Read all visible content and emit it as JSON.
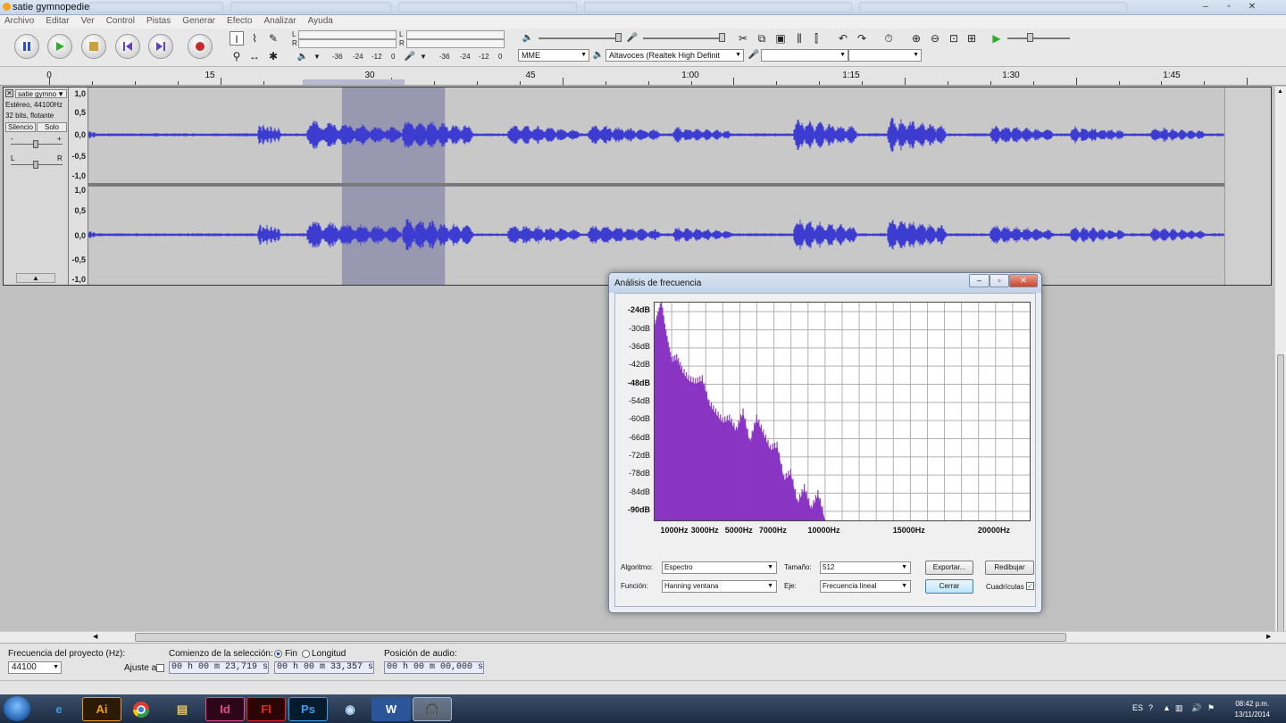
{
  "window": {
    "title": "satie gymnopedie"
  },
  "menu": [
    "Archivo",
    "Editar",
    "Ver",
    "Control",
    "Pistas",
    "Generar",
    "Efecto",
    "Analizar",
    "Ayuda"
  ],
  "toolbar": {
    "meter_L": "L",
    "meter_R": "R",
    "meter_scale": [
      "-36",
      "-24",
      "-12",
      "0"
    ],
    "host": "MME",
    "output_device": "Altavoces (Realtek High Definit",
    "input_device": "",
    "input_channels": ""
  },
  "ruler": {
    "labels": [
      "0",
      "15",
      "30",
      "45",
      "1:00",
      "1:15",
      "1:30",
      "1:45"
    ]
  },
  "track": {
    "name": "satie gymno",
    "info1": "Estéreo, 44100Hz",
    "info2": "32 bits, flotante",
    "mute": "Silencio",
    "solo": "Solo",
    "gain_minus": "-",
    "gain_plus": "+",
    "pan_L": "L",
    "pan_R": "R",
    "scale_top": [
      "1,0",
      "0,5",
      "0,0",
      "-0,5",
      "-1,0"
    ],
    "scale_bottom": [
      "1,0",
      "0,5",
      "0,0",
      "-0,5",
      "-1,0"
    ],
    "selection_seconds": [
      23.719,
      33.357
    ],
    "waveform_color": "#3c3cd0"
  },
  "dialog": {
    "title": "Análisis de frecuencia",
    "db_labels": [
      "-24dB",
      "-30dB",
      "-36dB",
      "-42dB",
      "-48dB",
      "-54dB",
      "-60dB",
      "-66dB",
      "-72dB",
      "-78dB",
      "-84dB",
      "-90dB"
    ],
    "hz_labels": [
      "1000Hz",
      "3000Hz",
      "5000Hz",
      "7000Hz",
      "10000Hz",
      "15000Hz",
      "20000Hz"
    ],
    "algoritmo_label": "Algoritmo:",
    "algoritmo_value": "Espectro",
    "tamano_label": "Tamaño:",
    "tamano_value": "512",
    "funcion_label": "Función:",
    "funcion_value": "Hanning ventana",
    "eje_label": "Eje:",
    "eje_value": "Frecuencia lineal",
    "exportar": "Exportar...",
    "redibujar": "Redibujar",
    "cerrar": "Cerrar",
    "cuadriculas": "Cuadrículas",
    "spectrum_color": "#8a35c4"
  },
  "chart_data": {
    "type": "area",
    "xlabel": "",
    "ylabel": "",
    "xlim": [
      0,
      22050
    ],
    "ylim": [
      -93,
      -21
    ],
    "x": [
      0,
      200,
      400,
      600,
      800,
      1000,
      1300,
      1600,
      2000,
      2400,
      2800,
      3200,
      3600,
      4000,
      4400,
      4800,
      5200,
      5600,
      6000,
      6400,
      6800,
      7200,
      7600,
      8000,
      8400,
      8800,
      9200,
      9600,
      10000
    ],
    "values": [
      -30,
      -26,
      -22,
      -30,
      -36,
      -41,
      -40,
      -44,
      -47,
      -48,
      -47,
      -55,
      -58,
      -61,
      -60,
      -64,
      -58,
      -68,
      -60,
      -65,
      -70,
      -69,
      -80,
      -78,
      -88,
      -83,
      -90,
      -85,
      -93
    ]
  },
  "selection_bar": {
    "project_rate_label": "Frecuencia del proyecto (Hz):",
    "project_rate_value": "44100",
    "snap_label": "Ajuste a",
    "selection_start_label": "Comienzo de la selección:",
    "fin_label": "Fin",
    "longitud_label": "Longitud",
    "audio_position_label": "Posición de audio:",
    "start_time": "00 h 00 m 23,719 s",
    "end_time": "00 h 00 m 33,357 s",
    "audio_position": "00 h 00 m 00,000 s"
  },
  "taskbar": {
    "lang": "ES",
    "time": "08:42 p.m.",
    "date": "13/11/2014",
    "apps": [
      "Ai",
      "Id",
      "Fl",
      "Ps",
      "W"
    ]
  }
}
